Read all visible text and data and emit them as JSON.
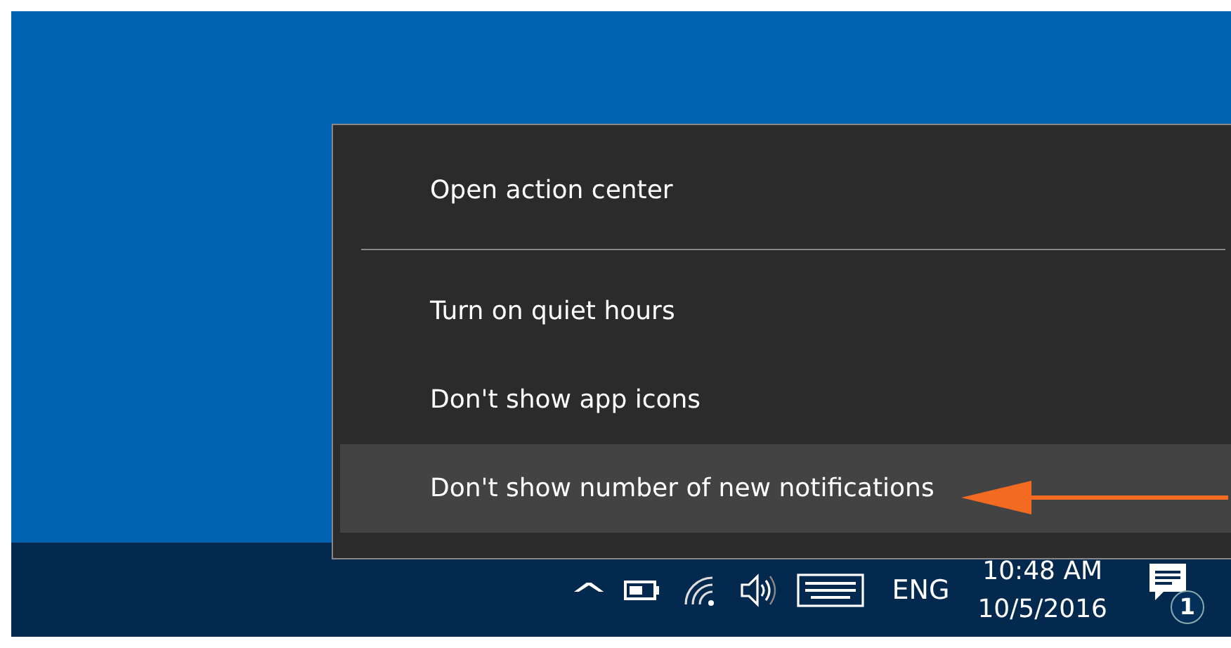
{
  "context_menu": {
    "items": [
      {
        "kind": "item",
        "label": "Open action center",
        "selected": false
      },
      {
        "kind": "separator"
      },
      {
        "kind": "item",
        "label": "Turn on quiet hours",
        "selected": false
      },
      {
        "kind": "item",
        "label": "Don't show app icons",
        "selected": false
      },
      {
        "kind": "item",
        "label": "Don't show number of new notifications",
        "selected": true
      }
    ]
  },
  "taskbar": {
    "tray_chevron": "^",
    "language": "ENG",
    "time": "10:48 AM",
    "date": "10/5/2016",
    "notification_count": "1"
  }
}
